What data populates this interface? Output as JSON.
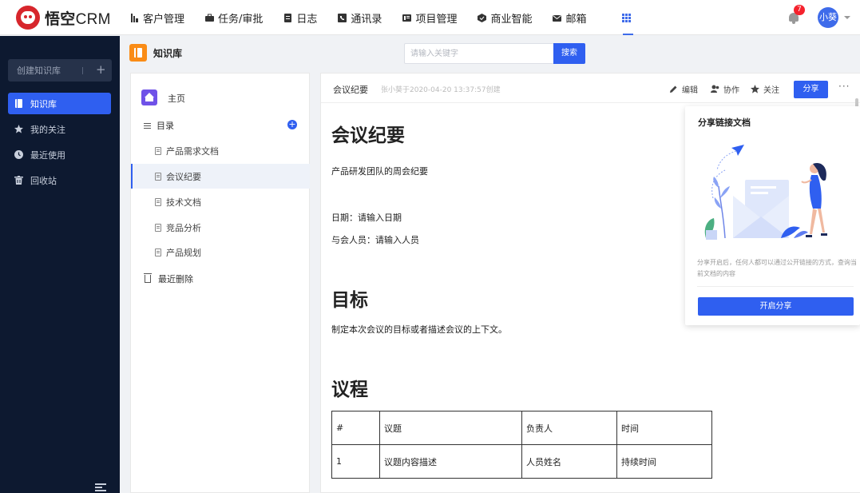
{
  "app": {
    "logo_name": "悟空",
    "logo_suffix": "CRM"
  },
  "nav": {
    "items": [
      {
        "label": "客户管理",
        "icon": "customer-icon"
      },
      {
        "label": "任务/审批",
        "icon": "briefcase-icon"
      },
      {
        "label": "日志",
        "icon": "log-icon"
      },
      {
        "label": "通讯录",
        "icon": "contacts-icon"
      },
      {
        "label": "项目管理",
        "icon": "project-icon"
      },
      {
        "label": "商业智能",
        "icon": "bi-icon"
      },
      {
        "label": "邮箱",
        "icon": "mail-icon"
      }
    ],
    "notification_count": "7",
    "user_name": "小葵"
  },
  "sidebar": {
    "create_label": "创建知识库",
    "create_plus": "+",
    "items": [
      {
        "label": "知识库",
        "icon": "book-icon",
        "active": true
      },
      {
        "label": "我的关注",
        "icon": "star-icon",
        "active": false
      },
      {
        "label": "最近使用",
        "icon": "clock-icon",
        "active": false
      },
      {
        "label": "回收站",
        "icon": "trash-icon",
        "active": false
      }
    ]
  },
  "header": {
    "title": "知识库",
    "search_placeholder": "请输入关键字",
    "search_button": "搜索"
  },
  "tree": {
    "home": "主页",
    "directory": "目录",
    "add_symbol": "+",
    "docs": [
      {
        "label": "产品需求文档",
        "active": false
      },
      {
        "label": "会议纪要",
        "active": true
      },
      {
        "label": "技术文档",
        "active": false
      },
      {
        "label": "竞品分析",
        "active": false
      },
      {
        "label": "产品规划",
        "active": false
      }
    ],
    "recently_deleted": "最近删除"
  },
  "doc": {
    "name": "会议纪要",
    "meta": "张小葵于2020-04-20 13:37:57创建",
    "toolbar": {
      "edit": "编辑",
      "collaborate": "协作",
      "follow": "关注",
      "share": "分享",
      "more": "···"
    },
    "heading": "会议纪要",
    "intro": "产品研发团队的周会纪要",
    "date_line": "日期：请输入日期",
    "attendees_line": "与会人员：请输入人员",
    "goal_heading": "目标",
    "goal_text": "制定本次会议的目标或者描述会议的上下文。",
    "agenda_heading": "议程",
    "table": {
      "headers": [
        "#",
        "议题",
        "负责人",
        "时间"
      ],
      "rows": [
        [
          "1",
          "议题内容描述",
          "人员姓名",
          "持续时间"
        ]
      ]
    }
  },
  "share_popover": {
    "title": "分享链接文档",
    "description": "分享开启后，任何人都可以通过公开链接的方式，查询当前文档的内容",
    "button": "开启分享"
  },
  "colors": {
    "primary": "#2f5ff0",
    "sidebar_bg": "#0d1930",
    "brand_red": "#d7262c",
    "kb_orange": "#fa8c16",
    "home_purple": "#6f52e8"
  }
}
